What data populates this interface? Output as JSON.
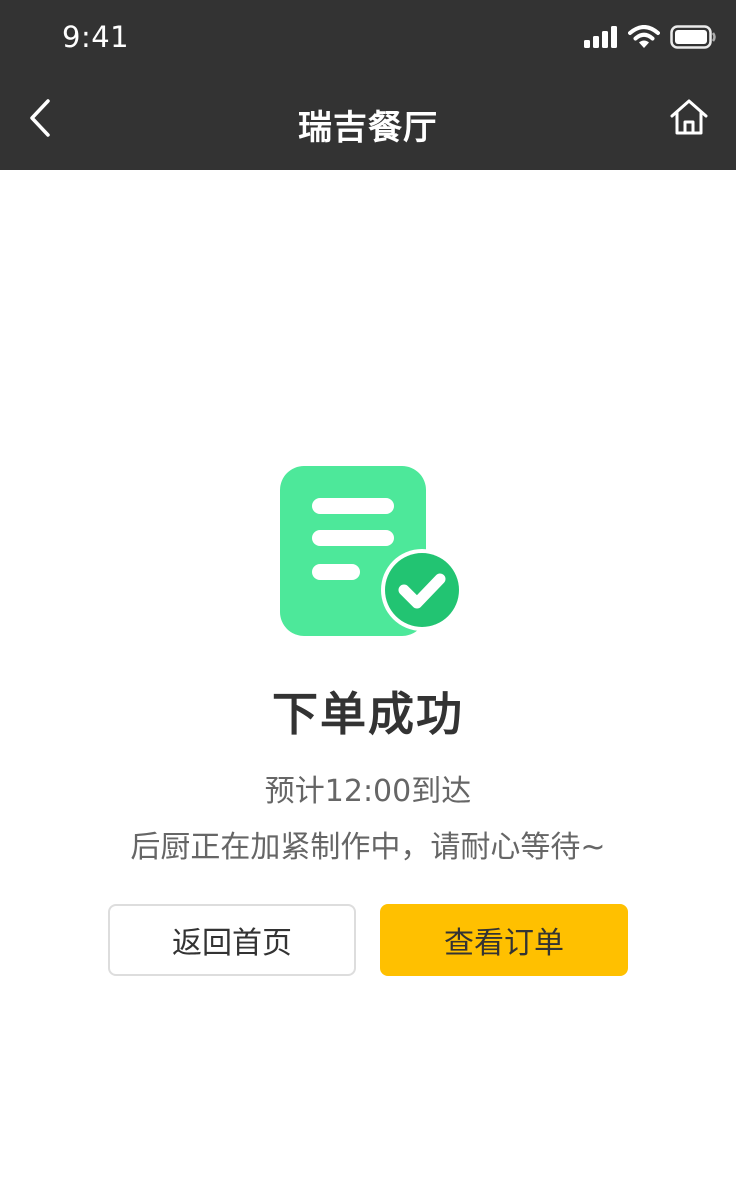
{
  "status_bar": {
    "time": "9:41",
    "icons": [
      "signal-icon",
      "wifi-icon",
      "battery-icon"
    ]
  },
  "nav": {
    "title": "瑞吉餐厅",
    "back_icon": "chevron-left-icon",
    "home_icon": "home-icon"
  },
  "result": {
    "icon": "order-success-icon",
    "headline": "下单成功",
    "eta": "预计12:00到达",
    "note": "后厨正在加紧制作中，请耐心等待~"
  },
  "actions": {
    "home_label": "返回首页",
    "order_label": "查看订单"
  },
  "colors": {
    "header_bg": "#333333",
    "accent": "#ffc000",
    "success_light": "#4de89a",
    "success_dark": "#22c472"
  }
}
